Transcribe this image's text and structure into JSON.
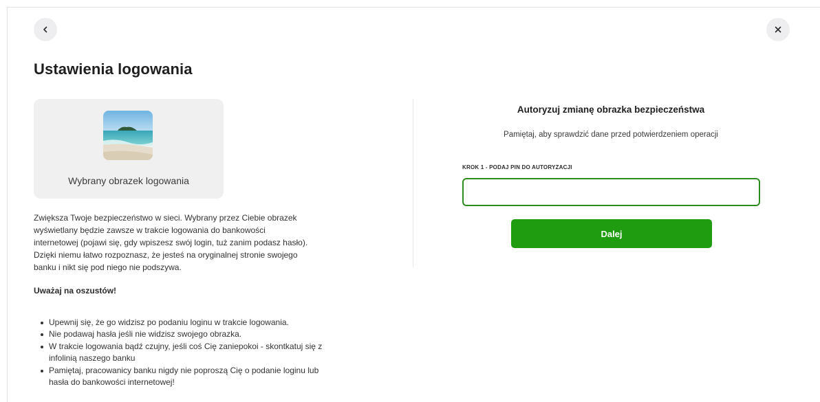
{
  "nav": {
    "back_icon": "chevron-left-icon",
    "close_icon": "close-icon"
  },
  "page": {
    "title": "Ustawienia logowania"
  },
  "security_image": {
    "caption": "Wybrany obrazek logowania",
    "image_subject": "beach-with-sea-and-island"
  },
  "description": {
    "text": "Zwiększa Twoje bezpieczeństwo w sieci. Wybrany przez Ciebie obrazek wyświetlany będzie zawsze w trakcie logowania do bankowości internetowej (pojawi się, gdy wpiszesz swój login, tuż zanim podasz hasło). Dzięki niemu łatwo rozpoznasz, że jesteś na oryginalnej stronie swojego banku i nikt się pod niego nie podszywa."
  },
  "warning": {
    "title": "Uważaj na oszustów!",
    "tips": [
      "Upewnij się, że go widzisz po podaniu loginu w trakcie logowania.",
      "Nie podawaj hasła jeśli nie widzisz swojego obrazka.",
      "W trakcie logowania bądź czujny, jeśli coś Cię zaniepokoi - skontkatuj się z infolinią naszego banku",
      "Pamiętaj, pracowanicy banku nigdy nie poproszą Cię o podanie loginu lub hasła do bankowości internetowej!"
    ]
  },
  "authorization": {
    "title": "Autoryzuj zmianę obrazka bezpieczeństwa",
    "subtitle": "Pamiętaj, aby sprawdzić dane przed potwierdzeniem operacji",
    "step_label": "KROK 1 - PODAJ PIN DO AUTORYZACJI",
    "pin_value": "",
    "pin_placeholder": "",
    "next_label": "Dalej"
  },
  "colors": {
    "primary_green": "#1f9c0f",
    "input_border_green": "#2e8b1f",
    "card_background": "#f0f0f1"
  }
}
